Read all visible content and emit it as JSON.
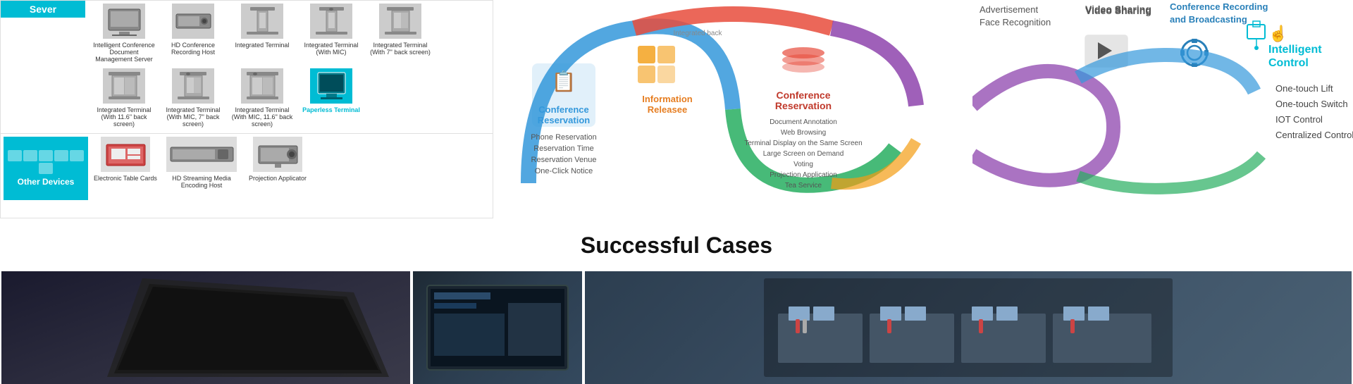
{
  "leftPanel": {
    "serverLabel": "Sever",
    "devices": [
      {
        "label": "Intelligent Conference\nDocument Management\nServer"
      },
      {
        "label": "HD Conference Recording\nHost"
      },
      {
        "label": "Integrated\nTerminal"
      },
      {
        "label": "Integrated\nTerminal\n(With MIC)"
      },
      {
        "label": "Integrated\nTerminal\n(With 7\" back\nscreen)"
      },
      {
        "label": "Integrated Terminal\n(With 11.6\" back\nscreen)"
      },
      {
        "label": "Integrated Terminal\n(With MIC, 7\" back\nscreen)"
      },
      {
        "label": "Integrated Terminal\n(With MIC, 11.6\" back\nscreen\n)"
      },
      {
        "label": "Paperless\nTerminal",
        "highlight": true
      }
    ],
    "otherDevicesLabel": "Other Devices",
    "bottomDevices": [
      {
        "label": "Electronic\nTable Cards"
      },
      {
        "label": "HD Streaming Media\nEncoding Host"
      },
      {
        "label": "Projection\nApplicator"
      }
    ]
  },
  "middleDiagram": {
    "conferenceReservation": "Conference Reservation",
    "informationRelease": "Information Releasee",
    "conferenceReservationRight": "Conference\nReservation",
    "phoneReservation": "Phone Reservation",
    "reservationTime": "Reservation Time",
    "reservationVenue": "Reservation Venue",
    "oneClickNotice": "One-Click Notice",
    "documentAnnotation": "Document Annotation",
    "webBrowsing": "Web Browsing",
    "terminalDisplay": "Terminal Display on the Same Screen",
    "largeScreen": "Large Screen on Demand",
    "voting": "Voting",
    "projectionApplication": "Projection Application",
    "teaService": "Tea Service"
  },
  "rightPanel": {
    "advertisement": "Advertisement",
    "faceRecognition": "Face Recognition",
    "videoSharing": "Video Sharing",
    "confRecordingTitle": "Conference Recording\nand Broadcasting",
    "intelligentControlTitle": "Intelligent Control",
    "oneTouchLift": "One-touch Lift",
    "oneTouchSwitch": "One-touch Switch",
    "iotControl": "IOT Control",
    "centralizedControl": "Centralized Control"
  },
  "successfulCases": {
    "title": "Successful Cases"
  }
}
